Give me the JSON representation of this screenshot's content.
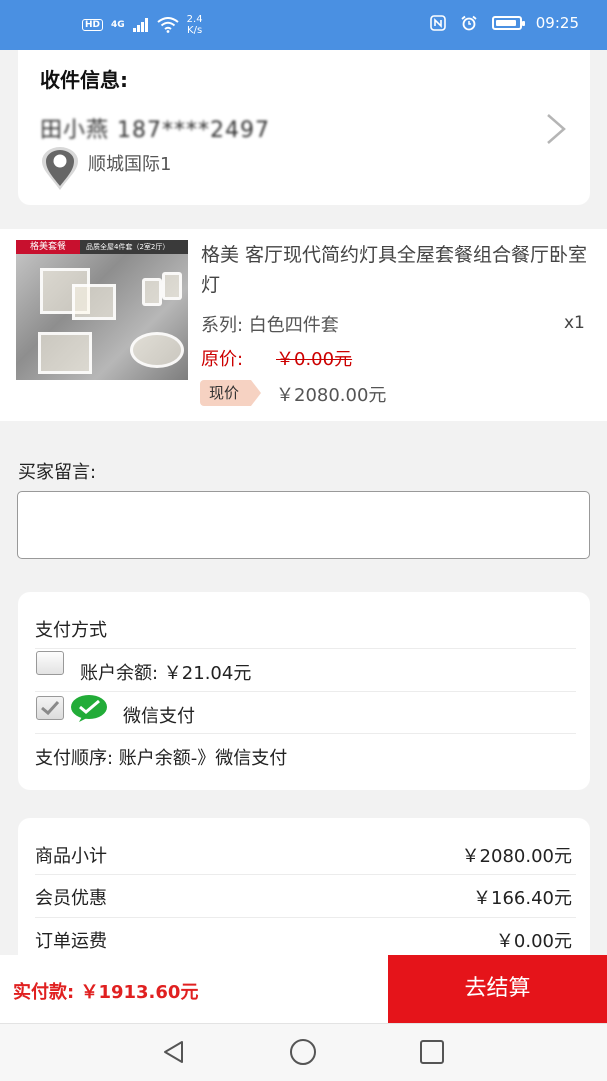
{
  "status_bar": {
    "hd": "HD",
    "network": "4G",
    "speed_value": "2.4",
    "speed_unit": "K/s",
    "time": "09:25",
    "battery_level": 0.9
  },
  "address": {
    "title": "收件信息:",
    "recipient_line": "田小燕 187****2497",
    "location": "顺城国际1"
  },
  "product": {
    "image_tag": "格美套餐",
    "image_banner": "品质全屋4件套（2室2厅）",
    "title": "格美 客厅现代简约灯具全屋套餐组合餐厅卧室灯",
    "series": "系列: 白色四件套",
    "quantity": "x1",
    "original_label": "原价:",
    "original_price": "￥0.00元",
    "now_label": "现价",
    "now_price": "￥2080.00元"
  },
  "message": {
    "label": "买家留言:",
    "value": ""
  },
  "payment": {
    "title": "支付方式",
    "balance_label": "账户余额:  ￥21.04元",
    "balance_checked": false,
    "wechat_label": "微信支付",
    "wechat_checked": true,
    "order_text": "支付顺序: 账户余额-》微信支付"
  },
  "summary": {
    "subtotal_label": "商品小计",
    "subtotal_value": "￥2080.00元",
    "member_label": "会员优惠",
    "member_value": "￥166.40元",
    "shipping_label": "订单运费",
    "shipping_value": "￥0.00元"
  },
  "footer": {
    "total_label": "实付款: ￥1913.60元",
    "checkout_label": "去结算"
  },
  "colors": {
    "status_bar": "#4a90e2",
    "accent_red": "#e5141a",
    "price_red": "#cc0000"
  }
}
